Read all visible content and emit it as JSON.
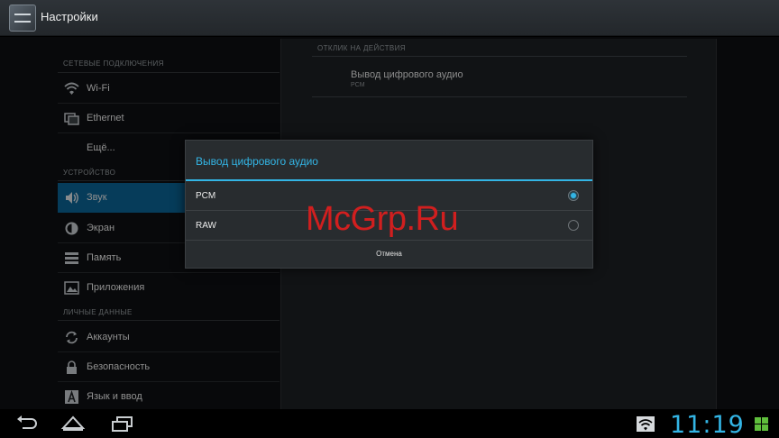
{
  "app": {
    "title": "Настройки",
    "icon": "settings-app-icon"
  },
  "sidebar": {
    "categories": [
      "СЕТЕВЫЕ ПОДКЛЮЧЕНИЯ",
      "УСТРОЙСТВО",
      "ЛИЧНЫЕ ДАННЫЕ"
    ],
    "items": [
      {
        "label": "Wi-Fi",
        "icon": "wifi-icon"
      },
      {
        "label": "Ethernet",
        "icon": "ethernet-icon"
      },
      {
        "label": "Ещё...",
        "icon": ""
      },
      {
        "label": "Звук",
        "icon": "speaker-icon",
        "active": true
      },
      {
        "label": "Экран",
        "icon": "brightness-icon"
      },
      {
        "label": "Память",
        "icon": "storage-icon"
      },
      {
        "label": "Приложения",
        "icon": "apps-icon"
      },
      {
        "label": "Аккаунты",
        "icon": "sync-icon"
      },
      {
        "label": "Безопасность",
        "icon": "lock-icon"
      },
      {
        "label": "Язык и ввод",
        "icon": "language-icon"
      }
    ]
  },
  "detail": {
    "category": "ОТКЛИК НА ДЕЙСТВИЯ",
    "setting_title": "Вывод цифрового аудио",
    "setting_value": "PCM"
  },
  "dialog": {
    "title": "Вывод цифрового аудио",
    "options": [
      {
        "label": "PCM",
        "selected": true
      },
      {
        "label": "RAW",
        "selected": false
      }
    ],
    "cancel_label": "Отмена"
  },
  "watermark": "McGrp.Ru",
  "statusbar": {
    "time": "11:19"
  },
  "colors": {
    "accent": "#33b5e5",
    "active_item": "#0a5c8a",
    "watermark": "#d11f1f"
  }
}
